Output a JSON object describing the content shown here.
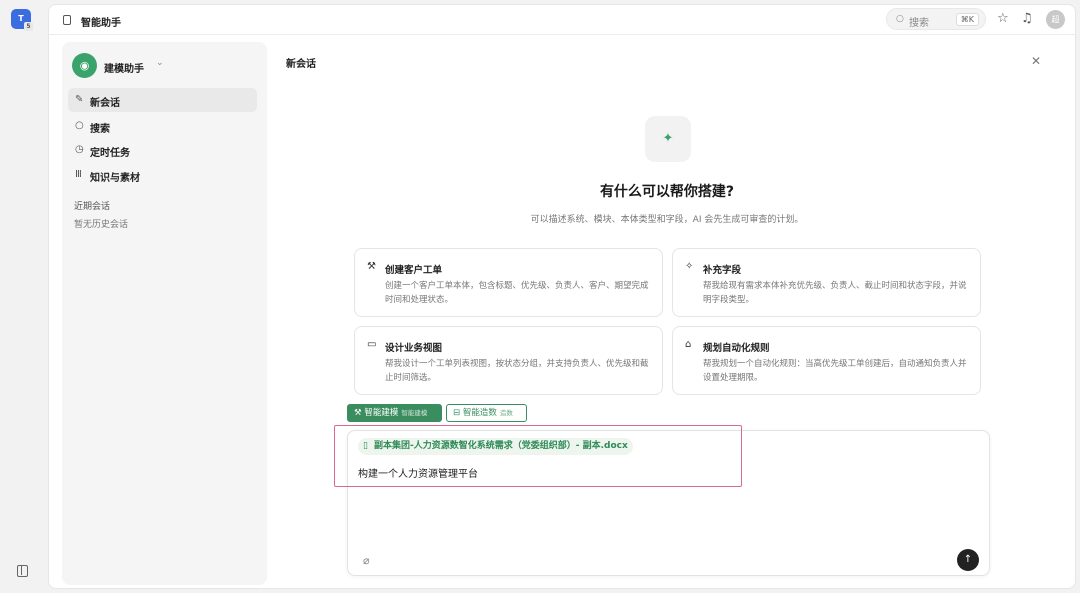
{
  "rail": {
    "app_initial": "T",
    "app_sub": "5"
  },
  "topbar": {
    "title": "智能助手",
    "search_placeholder": "搜索",
    "search_shortcut": "⌘K",
    "avatar_text": "超"
  },
  "sidebar": {
    "assistant_name": "建模助手",
    "nav": [
      {
        "label": "新会话",
        "icon": "edit-icon"
      },
      {
        "label": "搜索",
        "icon": "search-icon"
      },
      {
        "label": "定时任务",
        "icon": "clock-icon"
      },
      {
        "label": "知识与素材",
        "icon": "library-icon"
      }
    ],
    "recent_title": "近期会话",
    "recent_empty": "暂无历史会话"
  },
  "main": {
    "panel_title": "新会话",
    "hero_title": "有什么可以帮你搭建?",
    "hero_subtitle": "可以描述系统、模块、本体类型和字段，AI 会先生成可审查的计划。",
    "cards": [
      {
        "title": "创建客户工单",
        "desc": "创建一个客户工单本体，包含标题、优先级、负责人、客户、期望完成时间和处理状态。",
        "icon": "wand-icon"
      },
      {
        "title": "补充字段",
        "desc": "帮我给现有需求本体补充优先级、负责人、截止时间和状态字段，并说明字段类型。",
        "icon": "sparkle-icon"
      },
      {
        "title": "设计业务视图",
        "desc": "帮我设计一个工单列表视图，按状态分组，并支持负责人、优先级和截止时间筛选。",
        "icon": "chat-icon"
      },
      {
        "title": "规划自动化规则",
        "desc": "帮我规划一个自动化规则：当高优先级工单创建后，自动通知负责人并设置处理期限。",
        "icon": "robot-icon"
      }
    ]
  },
  "composer": {
    "mode_active": "智能建模",
    "mode_active_tag": "智能建模",
    "mode_other": "智能造数",
    "mode_other_tag": "造数",
    "attachment": "副本集团-人力资源数智化系统需求（党委组织部）- 副本.docx",
    "input_text": "构建一个人力资源管理平台"
  }
}
